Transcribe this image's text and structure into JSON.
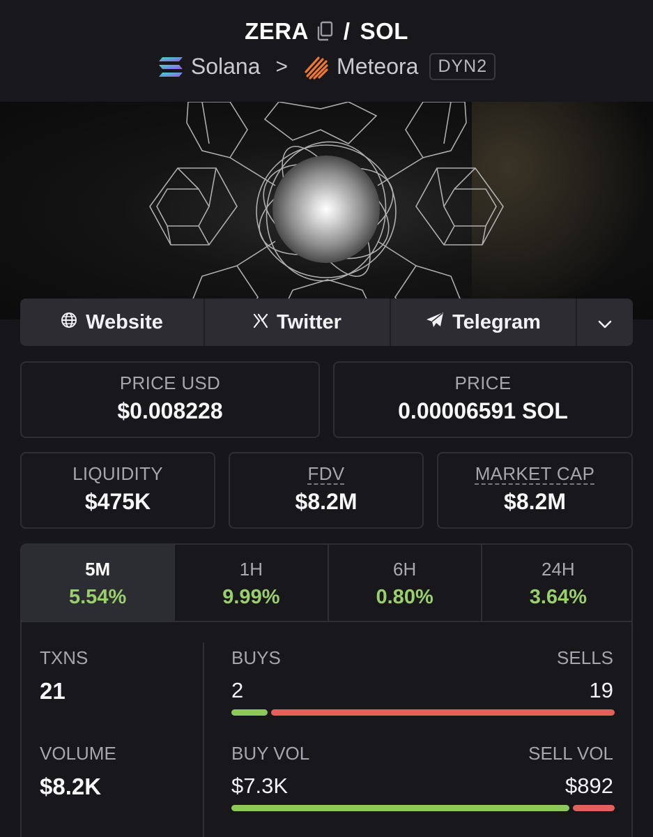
{
  "header": {
    "base_token": "ZERA",
    "separator": "/",
    "quote_token": "SOL",
    "chain_name": "Solana",
    "chain_sep": ">",
    "dex_name": "Meteora",
    "pool_badge": "DYN2"
  },
  "links": {
    "website": "Website",
    "twitter": "Twitter",
    "telegram": "Telegram"
  },
  "price_usd": {
    "label": "PRICE USD",
    "value": "$0.008228"
  },
  "price": {
    "label": "PRICE",
    "value": "0.00006591 SOL"
  },
  "liquidity": {
    "label": "LIQUIDITY",
    "value": "$475K"
  },
  "fdv": {
    "label": "FDV",
    "value": "$8.2M"
  },
  "market_cap": {
    "label": "MARKET CAP",
    "value": "$8.2M"
  },
  "timeframes": [
    {
      "label": "5M",
      "change": "5.54%",
      "active": true
    },
    {
      "label": "1H",
      "change": "9.99%",
      "active": false
    },
    {
      "label": "6H",
      "change": "0.80%",
      "active": false
    },
    {
      "label": "24H",
      "change": "3.64%",
      "active": false
    }
  ],
  "txns": {
    "label": "TXNS",
    "value": "21"
  },
  "volume": {
    "label": "VOLUME",
    "value": "$8.2K"
  },
  "buys": {
    "label": "BUYS",
    "value": "2"
  },
  "sells": {
    "label": "SELLS",
    "value": "19"
  },
  "buy_vol": {
    "label": "BUY VOL",
    "value": "$7.3K"
  },
  "sell_vol": {
    "label": "SELL VOL",
    "value": "$892"
  },
  "ratios": {
    "buys_share": 0.095,
    "buy_vol_share": 0.89
  },
  "colors": {
    "positive": "#9ad06a",
    "buy_bar": "#8dc95a",
    "sell_bar": "#e0625b",
    "background": "#16161b"
  },
  "icons": {
    "copy": "copy-icon",
    "chain": "solana-logo-icon",
    "dex": "meteora-logo-icon",
    "website": "globe-icon",
    "twitter": "x-logo-icon",
    "telegram": "paper-plane-icon",
    "more": "chevron-down-icon"
  }
}
